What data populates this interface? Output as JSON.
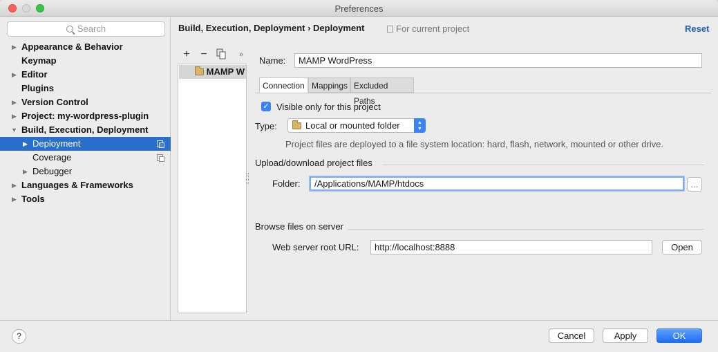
{
  "window": {
    "title": "Preferences"
  },
  "sidebar": {
    "search_placeholder": "Search",
    "items": [
      {
        "label": "Appearance & Behavior",
        "expandable": true
      },
      {
        "label": "Keymap",
        "expandable": false
      },
      {
        "label": "Editor",
        "expandable": true
      },
      {
        "label": "Plugins",
        "expandable": false
      },
      {
        "label": "Version Control",
        "expandable": true
      },
      {
        "label": "Project: my-wordpress-plugin",
        "expandable": true
      },
      {
        "label": "Build, Execution, Deployment",
        "expandable": true,
        "expanded": true
      },
      {
        "label": "Deployment",
        "expandable": true,
        "selected": true,
        "copy_icon": true
      },
      {
        "label": "Coverage",
        "expandable": false,
        "copy_icon": true
      },
      {
        "label": "Debugger",
        "expandable": true
      },
      {
        "label": "Languages & Frameworks",
        "expandable": true
      },
      {
        "label": "Tools",
        "expandable": true
      }
    ]
  },
  "header": {
    "breadcrumb": "Build, Execution, Deployment › Deployment",
    "scope": "For current project",
    "reset": "Reset"
  },
  "server_list": {
    "toolbar": {
      "add": "+",
      "remove": "−",
      "more": "»"
    },
    "servers": [
      {
        "label": "MAMP W"
      }
    ]
  },
  "config": {
    "name_label": "Name:",
    "name_value": "MAMP WordPress",
    "tabs": [
      {
        "label": "Connection",
        "active": true
      },
      {
        "label": "Mappings"
      },
      {
        "label": "Excluded Paths"
      }
    ],
    "visible_only_label": "Visible only for this project",
    "visible_only_checked": true,
    "type_label": "Type:",
    "type_value": "Local or mounted folder",
    "type_hint": "Project files are deployed to a file system location:  hard, flash, network, mounted or other drive.",
    "upload_section": "Upload/download project files",
    "folder_label": "Folder:",
    "folder_value": "/Applications/MAMP/htdocs",
    "browse_label": "...",
    "browse_section": "Browse files on server",
    "web_root_label": "Web server root URL:",
    "web_root_value": "http://localhost:8888",
    "open_label": "Open"
  },
  "footer": {
    "help": "?",
    "cancel": "Cancel",
    "apply": "Apply",
    "ok": "OK"
  },
  "colors": {
    "selection": "#2a6fc9",
    "accent": "#3a82f6",
    "link": "#1d5fbf"
  }
}
